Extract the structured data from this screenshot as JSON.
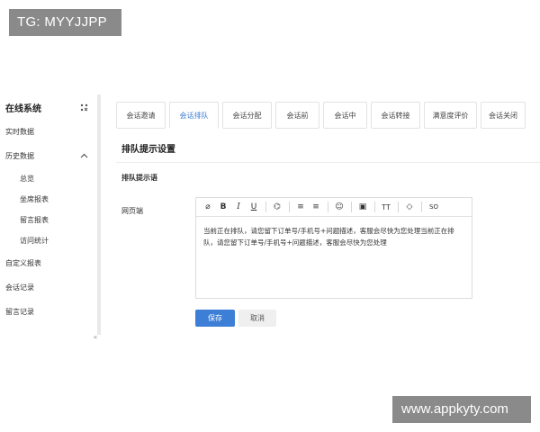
{
  "watermarks": {
    "top": "TG: MYYJJPP",
    "bottom": "www.appkyty.com"
  },
  "sidebar": {
    "title": "在线系统",
    "items": [
      {
        "label": "实时数据"
      },
      {
        "label": "历史数据",
        "expanded": true
      },
      {
        "label": "自定义报表"
      },
      {
        "label": "会话记录"
      },
      {
        "label": "留言记录"
      }
    ],
    "sub_items": [
      {
        "label": "总览"
      },
      {
        "label": "坐席报表"
      },
      {
        "label": "留言报表"
      },
      {
        "label": "访问统计"
      }
    ],
    "collapse_glyph": "«"
  },
  "tabs": [
    {
      "label": "会话邀请",
      "active": false
    },
    {
      "label": "会话排队",
      "active": true
    },
    {
      "label": "会话分配",
      "active": false
    },
    {
      "label": "会话前",
      "active": false
    },
    {
      "label": "会话中",
      "active": false
    },
    {
      "label": "会话转接",
      "active": false
    },
    {
      "label": "满意度评价",
      "active": false
    },
    {
      "label": "会话关闭",
      "active": false
    }
  ],
  "section": {
    "title": "排队提示设置",
    "subtitle": "排队提示语",
    "field_label": "网页端"
  },
  "editor": {
    "toolbar": {
      "attach": "⌀",
      "bold": "B",
      "italic": "I",
      "underline": "U",
      "link": "⌬",
      "bulleted": "≡",
      "numbered": "≡",
      "emoji": "☺",
      "image": "▣",
      "font_size": "TT",
      "clear": "◇",
      "source": "SO"
    },
    "content": "当前正在排队，请您留下订单号/手机号+问题描述，客服会尽快为您处理当前正在排队，请您留下订单号/手机号+问题描述，客服会尽快为您处理"
  },
  "actions": {
    "save": "保存",
    "cancel": "取消"
  },
  "colors": {
    "accent": "#3d7fd6",
    "border": "#dcdcdc",
    "watermark": "#8a8a8a"
  }
}
